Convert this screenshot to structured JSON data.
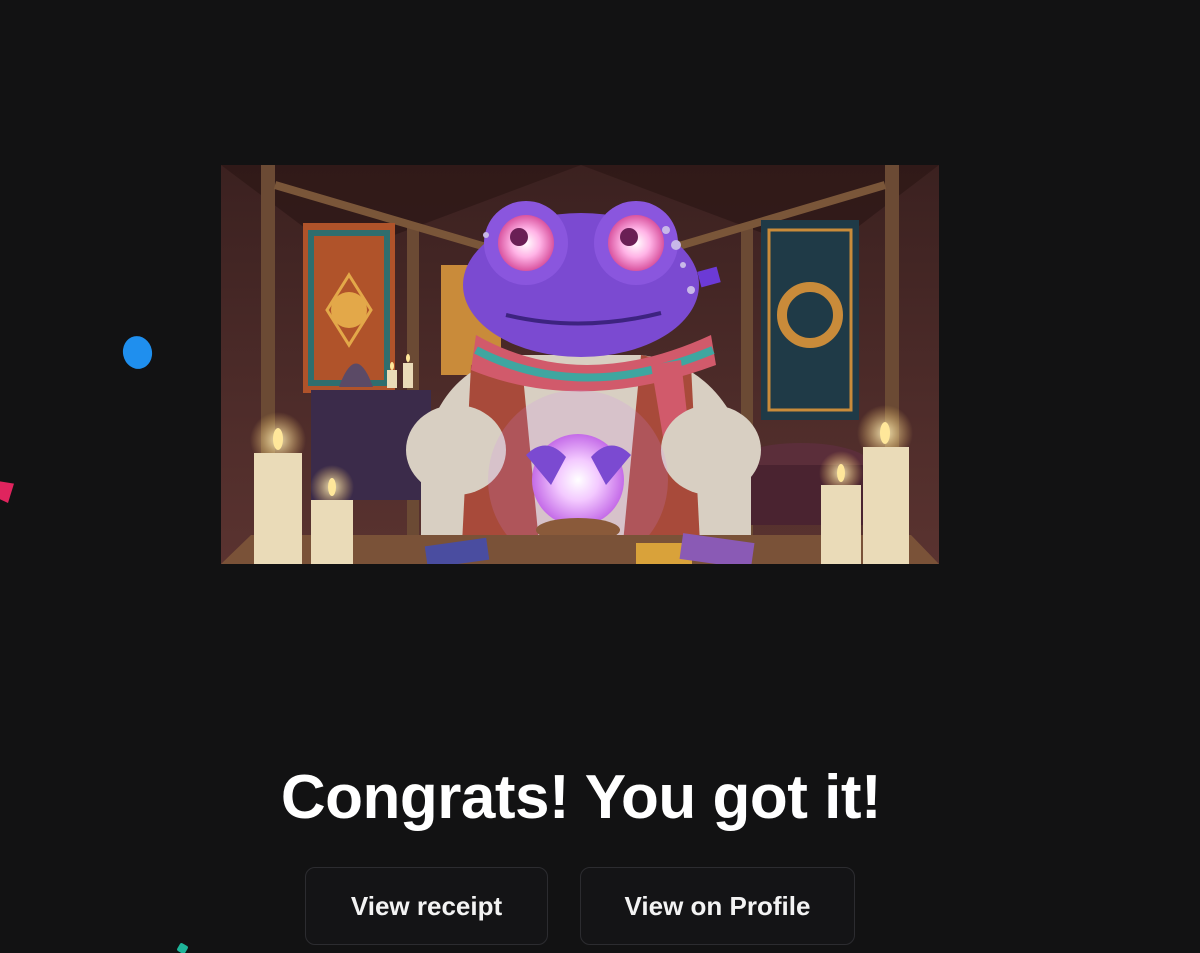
{
  "headline": "Congrats! You got it!",
  "actions": {
    "receipt_label": "View receipt",
    "profile_label": "View on Profile"
  },
  "artwork": {
    "alt": "Purple frog fortune teller holding a crystal ball"
  },
  "colors": {
    "background": "#121213",
    "button_background": "#141416",
    "button_border": "#2c2c30",
    "text": "#ffffff"
  }
}
